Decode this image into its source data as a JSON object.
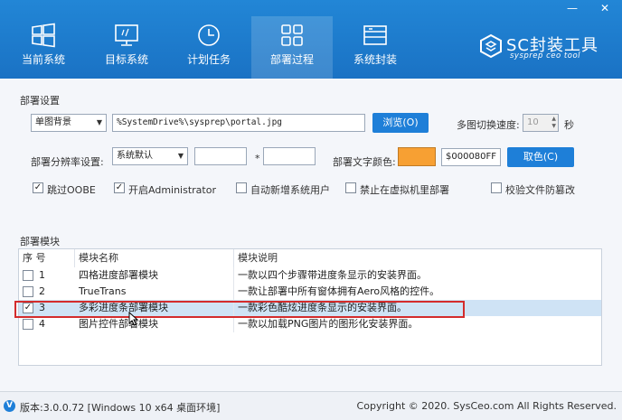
{
  "window": {
    "minimize_glyph": "—",
    "close_glyph": "✕"
  },
  "nav": {
    "tabs": [
      {
        "label": "当前系统",
        "icon": "windows-icon"
      },
      {
        "label": "目标系统",
        "icon": "monitor-icon"
      },
      {
        "label": "计划任务",
        "icon": "clock-icon"
      },
      {
        "label": "部署过程",
        "icon": "grid-icon",
        "active": true
      },
      {
        "label": "系统封装",
        "icon": "package-icon"
      }
    ]
  },
  "logo": {
    "brand": "SC封装工具",
    "tagline": "sysprep ceo tool"
  },
  "deploy_settings": {
    "section_title": "部署设置",
    "background_mode": "单图背景",
    "image_path": "%SystemDrive%\\sysprep\\portal.jpg",
    "browse_label": "浏览(O)",
    "multi_image_label": "多图切换速度:",
    "multi_image_value": "10",
    "seconds_unit": "秒",
    "resolution_label": "部署分辨率设置:",
    "resolution_value": "系统默认",
    "resolution_separator": "*",
    "text_color_label": "部署文字颜色:",
    "text_color_value": "$000080FF",
    "pick_color_label": "取色(C)",
    "text_color_swatch": "#f7a033",
    "options": [
      {
        "label": "跳过OOBE",
        "checked": true
      },
      {
        "label": "开启Administrator",
        "checked": true
      },
      {
        "label": "自动新增系统用户",
        "checked": false
      },
      {
        "label": "禁止在虚拟机里部署",
        "checked": false
      },
      {
        "label": "校验文件防篡改",
        "checked": false
      }
    ]
  },
  "modules": {
    "section_title": "部署模块",
    "columns": [
      "序 号",
      "模块名称",
      "模块说明"
    ],
    "rows": [
      {
        "no": "1",
        "name": "四格进度部署模块",
        "desc": "一款以四个步骤带进度条显示的安装界面。",
        "checked": false
      },
      {
        "no": "2",
        "name": "TrueTrans",
        "desc": "一款让部署中所有窗体拥有Aero风格的控件。",
        "checked": false
      },
      {
        "no": "3",
        "name": "多彩进度条部署模块",
        "desc": "一款彩色酷炫进度条显示的安装界面。",
        "checked": true,
        "selected": true
      },
      {
        "no": "4",
        "name": "图片控件部署模块",
        "desc": "一款以加载PNG图片的图形化安装界面。",
        "checked": false
      }
    ]
  },
  "status": {
    "version": "版本:3.0.0.72 [Windows 10 x64 桌面环境]",
    "copyright": "Copyright © 2020. SysCeo.com All Rights Reserved."
  },
  "colors": {
    "header_blue": "#1e7fd8",
    "accent_button": "#1e7fd8",
    "highlight_red": "#d42c2c"
  }
}
